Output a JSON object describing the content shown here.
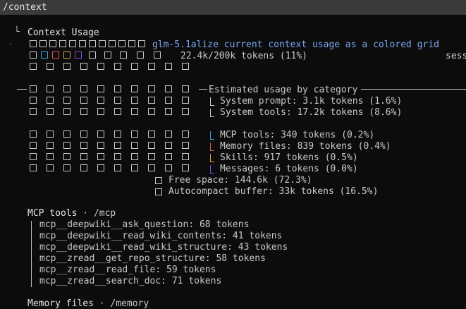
{
  "command": "/context",
  "context_usage": {
    "title": "Context Usage",
    "model_line": "glm-5.1alize current context usage as a colored grid",
    "tokens_line": "22.4k/200k tokens (11%)",
    "overflow_text": "sess"
  },
  "categories": {
    "heading": "Estimated usage by category",
    "items": [
      {
        "label": "System prompt: 3.1k tokens (1.6%)",
        "color": "#c9c9c9"
      },
      {
        "label": "System tools: 17.2k tokens (8.6%)",
        "color": "#c9c9c9"
      },
      {
        "label": "MCP tools: 340 tokens (0.2%)",
        "color": "#33a5d8"
      },
      {
        "label": "Memory files: 839 tokens (0.4%)",
        "color": "#e05757"
      },
      {
        "label": "Skills: 917 tokens (0.5%)",
        "color": "#e2a33a"
      },
      {
        "label": "Messages: 6 tokens (0.0%)",
        "color": "#7b4fe0"
      },
      {
        "label": "Free space: 144.6k (72.3%)",
        "color": "#c9c9c9"
      },
      {
        "label": "Autocompact buffer: 33k tokens (16.5%)",
        "color": "#c9c9c9"
      }
    ]
  },
  "mcp_tools": {
    "heading": "MCP tools",
    "sep": "·",
    "path": "/mcp",
    "items": [
      "mcp__deepwiki__ask_question: 68 tokens",
      "mcp__deepwiki__read_wiki_contents: 41 tokens",
      "mcp__deepwiki__read_wiki_structure: 43 tokens",
      "mcp__zread__get_repo_structure: 58 tokens",
      "mcp__zread__read_file: 59 tokens",
      "mcp__zread__search_doc: 71 tokens"
    ]
  },
  "memory_files": {
    "heading": "Memory files",
    "sep": "·",
    "path": "/memory"
  },
  "colors": {
    "background": "#0c0c0c",
    "title_bar": "#3b3b3b",
    "mcp": "#33a5d8",
    "memory": "#e05757",
    "skills": "#e2a33a",
    "messages": "#7b4fe0",
    "accent_text": "#7aa7f5"
  }
}
